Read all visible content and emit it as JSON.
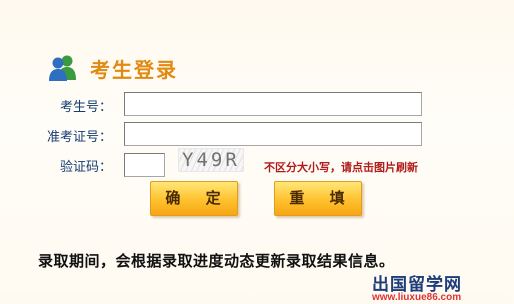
{
  "login": {
    "title": "考生登录",
    "exam_id_label": "考生号：",
    "exam_id_value": "",
    "ticket_label": "准考证号：",
    "ticket_value": "",
    "captcha_label": "验证码：",
    "captcha_value": "",
    "captcha_text": "Y49R",
    "captcha_hint": "不区分大小写，请点击图片刷新",
    "confirm_label": "确 定",
    "reset_label": "重 填"
  },
  "notice": "录取期间，会根据录取进度动态更新录取结果信息。",
  "watermark": {
    "brand": "出国留学网",
    "url": "www.liuxue86.com"
  },
  "colors": {
    "title": "#e08a12",
    "label": "#163c73",
    "hint": "#b01a1a",
    "button": "#ffc12e"
  },
  "icons": {
    "title_icon": "users-icon"
  }
}
